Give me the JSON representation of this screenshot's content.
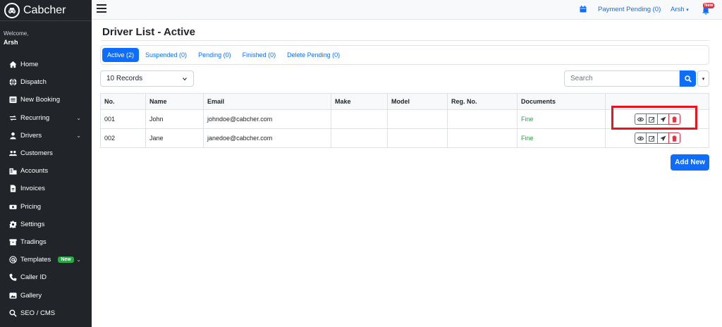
{
  "brand": {
    "name": "Cabcher"
  },
  "sidebar": {
    "welcome": "Welcome,",
    "user": "Arsh",
    "items": [
      {
        "label": "Home",
        "icon": "home-icon"
      },
      {
        "label": "Dispatch",
        "icon": "globe-icon"
      },
      {
        "label": "New Booking",
        "icon": "list-icon"
      },
      {
        "label": "Recurring",
        "icon": "repeat-icon",
        "expandable": true
      },
      {
        "label": "Drivers",
        "icon": "user-icon",
        "expandable": true
      },
      {
        "label": "Customers",
        "icon": "users-icon"
      },
      {
        "label": "Accounts",
        "icon": "building-icon"
      },
      {
        "label": "Invoices",
        "icon": "file-icon"
      },
      {
        "label": "Pricing",
        "icon": "money-icon"
      },
      {
        "label": "Settings",
        "icon": "gear-icon"
      },
      {
        "label": "Tradings",
        "icon": "box-icon"
      },
      {
        "label": "Templates",
        "icon": "at-icon",
        "badge": "New",
        "expandable": true
      },
      {
        "label": "Caller ID",
        "icon": "phone-icon"
      },
      {
        "label": "Gallery",
        "icon": "image-icon"
      },
      {
        "label": "SEO / CMS",
        "icon": "search-icon"
      }
    ]
  },
  "topbar": {
    "payment_pending": "Payment Pending (0)",
    "user": "Arsh",
    "notification_badge": "New"
  },
  "page": {
    "title": "Driver List - Active",
    "tabs": [
      {
        "label": "Active (2)",
        "active": true
      },
      {
        "label": "Suspended (0)"
      },
      {
        "label": "Pending (0)"
      },
      {
        "label": "Finished (0)"
      },
      {
        "label": "Delete Pending (0)"
      }
    ],
    "records_select": "10 Records",
    "search_placeholder": "Search",
    "add_new": "Add New"
  },
  "table": {
    "columns": [
      "No.",
      "Name",
      "Email",
      "Make",
      "Model",
      "Reg. No.",
      "Documents",
      ""
    ],
    "rows": [
      {
        "no": "001",
        "name": "John",
        "email": "johndoe@cabcher.com",
        "make": "",
        "model": "",
        "reg": "",
        "documents": "Fine"
      },
      {
        "no": "002",
        "name": "Jane",
        "email": "janedoe@cabcher.com",
        "make": "",
        "model": "",
        "reg": "",
        "documents": "Fine"
      }
    ]
  },
  "colors": {
    "sidebar_bg": "#212529",
    "primary": "#0d6efd",
    "success": "#28a745",
    "danger": "#dc3545",
    "highlight": "#e5161f"
  }
}
